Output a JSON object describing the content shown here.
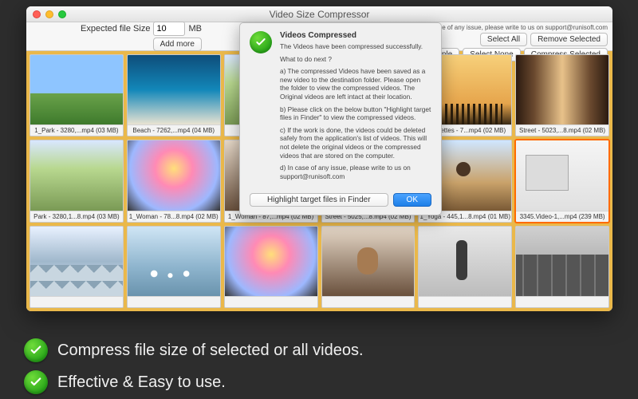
{
  "window": {
    "title": "Video Size Compressor"
  },
  "toolbar": {
    "expected_label": "Expected file Size",
    "expected_value": "10",
    "expected_unit": "MB",
    "add_more": "Add more",
    "support_line": "In case of any issue, please write to us on support@runisoft.com",
    "buttons": {
      "select_all": "Select All",
      "remove_selected": "Remove Selected",
      "select_multiple": "Select Multiple",
      "select_none": "Select None",
      "compress_selected": "Compress Selected"
    }
  },
  "thumbs": [
    {
      "cap": "1_Park - 3280,...mp4 (03 MB)",
      "cls": "bg-park"
    },
    {
      "cap": "Beach - 7262,...mp4 (04 MB)",
      "cls": "bg-beach"
    },
    {
      "cap": "",
      "cls": "bg-path"
    },
    {
      "cap": "",
      "cls": "bg-sunset"
    },
    {
      "cap": "...houettes - 7...mp4 (02 MB)",
      "cls": "bg-sil"
    },
    {
      "cap": "Street - 5023,...8.mp4 (02 MB)",
      "cls": "bg-street"
    },
    {
      "cap": "Park - 3280,1...8.mp4 (03 MB)",
      "cls": "bg-path"
    },
    {
      "cap": "1_Woman - 78...8.mp4 (02 MB)",
      "cls": "bg-smoke"
    },
    {
      "cap": "1_Woman - 87,...mp4 (02 MB)",
      "cls": "bg-woman"
    },
    {
      "cap": "Street - 5025,...8.mp4 (02 MB)",
      "cls": "bg-sunset"
    },
    {
      "cap": "1_Yoga - 445,1...8.mp4 (01 MB)",
      "cls": "bg-yoga"
    },
    {
      "cap": "3345.Video-1,...mp4 (239 MB)",
      "cls": "bg-desk",
      "selected": true
    },
    {
      "cap": "",
      "cls": "bg-mountain"
    },
    {
      "cap": "",
      "cls": "bg-swans"
    },
    {
      "cap": "",
      "cls": "bg-smoke"
    },
    {
      "cap": "",
      "cls": "bg-woman"
    },
    {
      "cap": "",
      "cls": "bg-walk"
    },
    {
      "cap": "",
      "cls": "bg-city"
    }
  ],
  "dialog": {
    "title": "Videos Compressed",
    "subtitle": "The Videos have been compressed successfully.",
    "next": "What to do next ?",
    "body_a": "a) The compressed Videos have been saved as a new video to the destination folder. Please open the folder to view the compressed videos. The Original videos are left intact at their location.",
    "body_b": "b) Please click on the below button \"Highlight target files in Finder\" to view the compressed videos.",
    "body_c": "c) If the work is done, the videos could be deleted safely from the application's list of videos. This will not delete the original videos or the compressed videos that are stored on the computer.",
    "body_d": "d) In case of any issue, please write to us on support@runisoft.com",
    "highlight_btn": "Highlight target files in Finder",
    "ok_btn": "OK"
  },
  "banner": {
    "line1": "Compress file size of selected or all videos.",
    "line2": "Effective & Easy to use."
  }
}
